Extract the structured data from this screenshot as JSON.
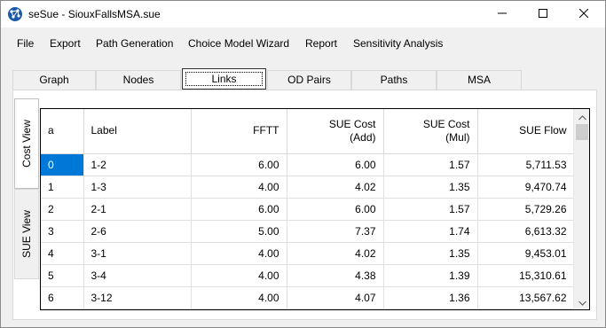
{
  "window": {
    "title": "seSue - SiouxFallsMSA.sue",
    "app_icon": "network-app-icon",
    "controls": {
      "minimize": "minimize-icon",
      "maximize": "maximize-icon",
      "close": "close-icon"
    }
  },
  "menu": {
    "file": "File",
    "export": "Export",
    "path_generation": "Path Generation",
    "choice_model_wizard": "Choice Model Wizard",
    "report": "Report",
    "sensitivity_analysis": "Sensitivity Analysis"
  },
  "tabs": [
    "Graph",
    "Nodes",
    "Links",
    "OD Pairs",
    "Paths",
    "MSA"
  ],
  "active_tab": "Links",
  "side_tabs": {
    "cost_view": "Cost View",
    "sue_view": "SUE View"
  },
  "table": {
    "headers": {
      "index": "a",
      "label": "Label",
      "fftt": "FFTT",
      "sue_cost_add_line1": "SUE Cost",
      "sue_cost_add_line2": "(Add)",
      "sue_cost_mul_line1": "SUE Cost",
      "sue_cost_mul_line2": "(Mul)",
      "sue_flow": "SUE Flow"
    },
    "rows": [
      {
        "index": "0",
        "label": "1-2",
        "fftt": "6.00",
        "add": "6.00",
        "mul": "1.57",
        "flow": "5,711.53"
      },
      {
        "index": "1",
        "label": "1-3",
        "fftt": "4.00",
        "add": "4.02",
        "mul": "1.35",
        "flow": "9,470.74"
      },
      {
        "index": "2",
        "label": "2-1",
        "fftt": "6.00",
        "add": "6.00",
        "mul": "1.57",
        "flow": "5,729.26"
      },
      {
        "index": "3",
        "label": "2-6",
        "fftt": "5.00",
        "add": "7.37",
        "mul": "1.74",
        "flow": "6,613.32"
      },
      {
        "index": "4",
        "label": "3-1",
        "fftt": "4.00",
        "add": "4.02",
        "mul": "1.35",
        "flow": "9,453.01"
      },
      {
        "index": "5",
        "label": "3-4",
        "fftt": "4.00",
        "add": "4.38",
        "mul": "1.39",
        "flow": "15,310.61"
      },
      {
        "index": "6",
        "label": "3-12",
        "fftt": "4.00",
        "add": "4.07",
        "mul": "1.36",
        "flow": "13,567.62"
      }
    ],
    "selected_row": 0
  },
  "colors": {
    "selection": "#0078d7",
    "chrome": "#f0f0f0"
  }
}
